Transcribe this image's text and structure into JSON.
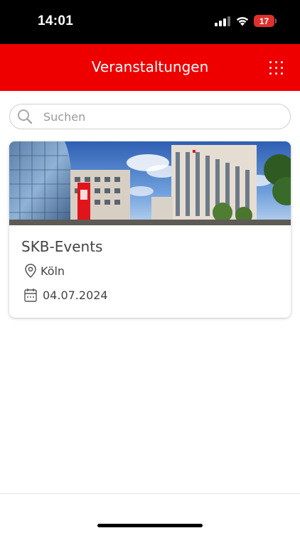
{
  "status_bar": {
    "time": "14:01",
    "battery_level": "17",
    "battery_color": "#e0302c"
  },
  "header": {
    "title": "Veranstaltungen",
    "menu_icon": "grid-menu-icon",
    "background": "#ee0000"
  },
  "search": {
    "placeholder": "Suchen",
    "value": "",
    "icon": "search-icon"
  },
  "events": [
    {
      "title": "SKB-Events",
      "location": "Köln",
      "date": "04.07.2024",
      "location_icon": "location-pin-icon",
      "date_icon": "calendar-icon"
    }
  ]
}
